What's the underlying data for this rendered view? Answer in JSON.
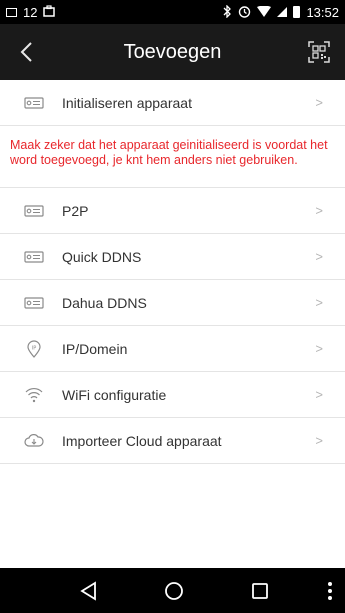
{
  "status_bar": {
    "left_text": "12",
    "time": "13:52"
  },
  "header": {
    "title": "Toevoegen",
    "back_icon": "chevron-left-icon",
    "scan_icon": "qr-scan-icon"
  },
  "menu": {
    "init_item": {
      "label": "Initialiseren apparaat",
      "icon": "device-icon"
    },
    "warning": "Maak zeker dat het apparaat geinitialiseerd is voordat het word toegevoegd, je knt hem anders niet gebruiken.",
    "items": [
      {
        "label": "P2P",
        "icon": "device-icon"
      },
      {
        "label": "Quick DDNS",
        "icon": "device-icon"
      },
      {
        "label": "Dahua DDNS",
        "icon": "device-icon"
      },
      {
        "label": "IP/Domein",
        "icon": "ip-pin-icon"
      },
      {
        "label": "WiFi configuratie",
        "icon": "wifi-icon"
      },
      {
        "label": "Importeer Cloud apparaat",
        "icon": "cloud-import-icon"
      }
    ],
    "chevron": ">"
  },
  "colors": {
    "warning": "#e8272c",
    "appbar": "#1a1a1a"
  }
}
